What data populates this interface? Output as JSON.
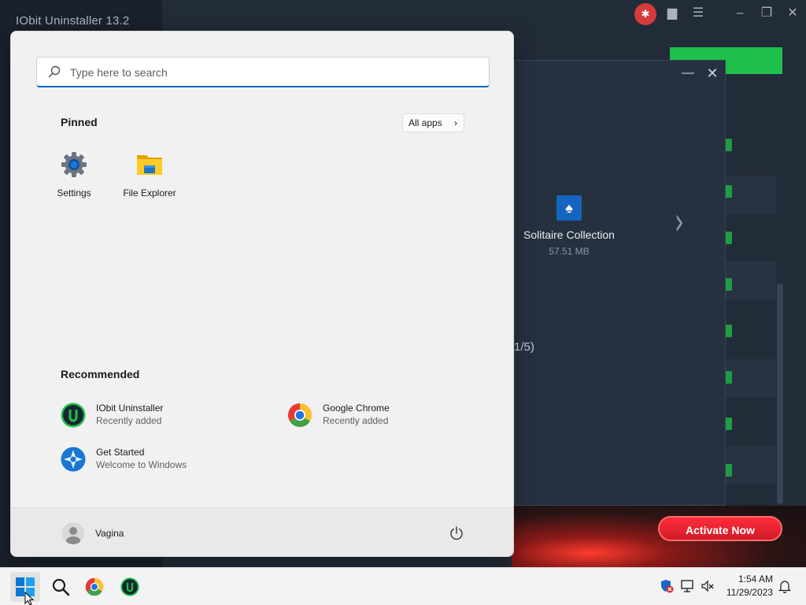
{
  "background_window": {
    "title": "IObit Uninstaller 13.2",
    "gift_icon": "gift-icon",
    "activate_label": "Activate Now"
  },
  "detail_panel": {
    "app_name": "Solitaire Collection",
    "app_size": "57.51 MB",
    "pager": "(1/5)"
  },
  "start_menu": {
    "search": {
      "placeholder": "Type here to search"
    },
    "pinned_heading": "Pinned",
    "all_apps_label": "All apps",
    "pinned_apps": [
      {
        "label": "Settings",
        "icon": "settings-gear-icon"
      },
      {
        "label": "File Explorer",
        "icon": "folder-icon"
      }
    ],
    "recommended_heading": "Recommended",
    "recommended": [
      {
        "title": "IObit Uninstaller",
        "subtitle": "Recently added",
        "icon": "iobit-uninstaller-icon"
      },
      {
        "title": "Google Chrome",
        "subtitle": "Recently added",
        "icon": "chrome-icon"
      },
      {
        "title": "Get Started",
        "subtitle": "Welcome to Windows",
        "icon": "get-started-icon"
      }
    ],
    "user_name": "Vagina"
  },
  "taskbar": {
    "items": [
      "windows-start-icon",
      "search-icon",
      "chrome-icon",
      "iobit-uninstaller-icon"
    ],
    "clock_time": "1:54 AM",
    "clock_date": "11/29/2023"
  },
  "colors": {
    "accent": "#0067c0",
    "iobit_green": "#1fbf4c",
    "activate_red": "#e8202e"
  }
}
